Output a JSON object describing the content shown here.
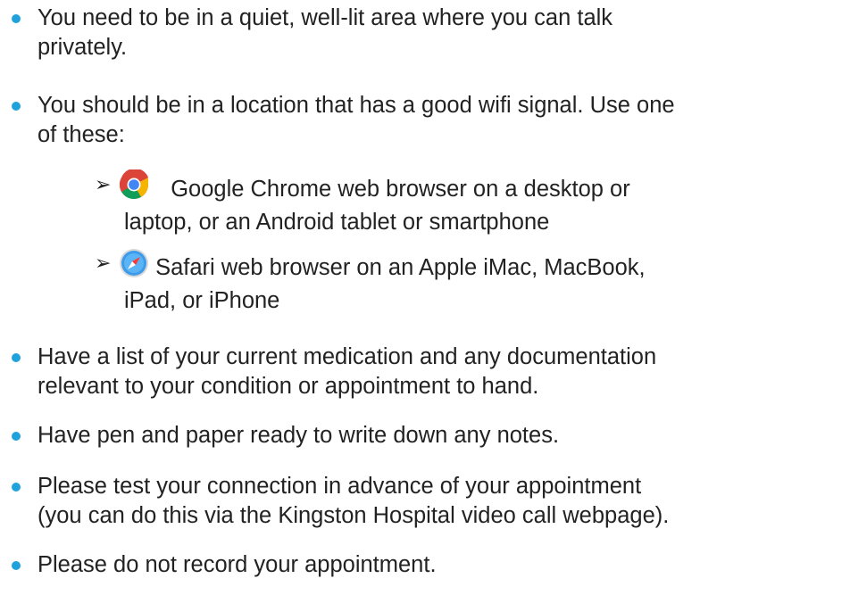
{
  "bullets": [
    {
      "lines": [
        "You need to be in a quiet, well-lit area where you can talk",
        "privately."
      ]
    },
    {
      "lines": [
        "You should be in a location that has a good wifi signal. Use one",
        "of these:"
      ]
    },
    {
      "lines": [
        "Have a list of your current medication and any documentation",
        "relevant to your condition or appointment to hand."
      ]
    },
    {
      "lines": [
        "Have pen and paper ready to write down any notes."
      ]
    },
    {
      "lines": [
        "Please test your connection in advance of your appointment",
        "(you can do this via the Kingston Hospital video call webpage)."
      ]
    },
    {
      "lines": [
        "Please do not record your appointment."
      ]
    }
  ],
  "browsers": [
    {
      "icon": "chrome-icon",
      "lines": [
        "Google Chrome web browser on a desktop or",
        "laptop, or an Android tablet or smartphone"
      ]
    },
    {
      "icon": "safari-icon",
      "lines": [
        "Safari web browser on an Apple iMac, MacBook,",
        "iPad, or iPhone"
      ]
    }
  ],
  "colors": {
    "bullet": "#1fa2db",
    "text": "#222222"
  },
  "sub_bullet_symbol": "➢"
}
